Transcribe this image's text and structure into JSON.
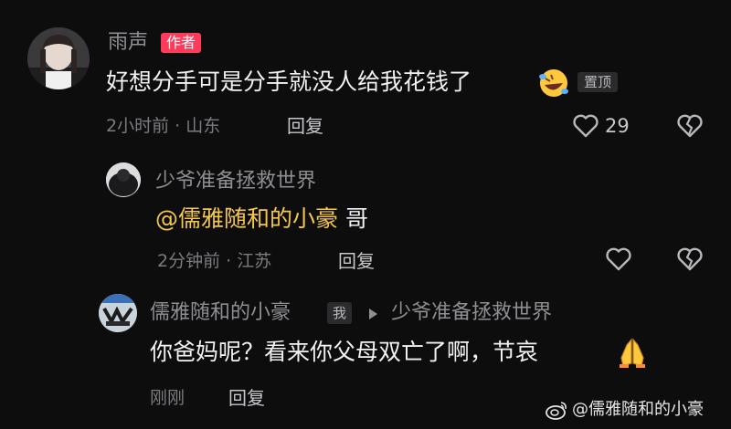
{
  "comments": [
    {
      "username": "雨声",
      "author_badge": "作者",
      "text": "好想分手可是分手就没人给我花钱了",
      "emoji_icon": "rofl-emoji",
      "pin_badge": "置顶",
      "time_location": "2小时前 · 山东",
      "reply_label": "回复",
      "like_count": "29"
    },
    {
      "username": "少爷准备拯救世界",
      "mention": "@儒雅随和的小豪",
      "text": " 哥",
      "time_location": "2分钟前 · 江苏",
      "reply_label": "回复"
    },
    {
      "username": "儒雅随和的小豪",
      "me_badge": "我",
      "reply_to": "少爷准备拯救世界",
      "text": "你爸妈呢？看来你父母双亡了啊，节哀",
      "emoji_icon": "folded-hands-emoji",
      "time_location": "刚刚",
      "reply_label": "回复"
    }
  ],
  "watermark": "@儒雅随和的小豪",
  "colors": {
    "background": "#0d0d0e",
    "author_badge": "#ff3b5c",
    "mention": "#f5c84b",
    "secondary_text": "#8e8e93"
  }
}
